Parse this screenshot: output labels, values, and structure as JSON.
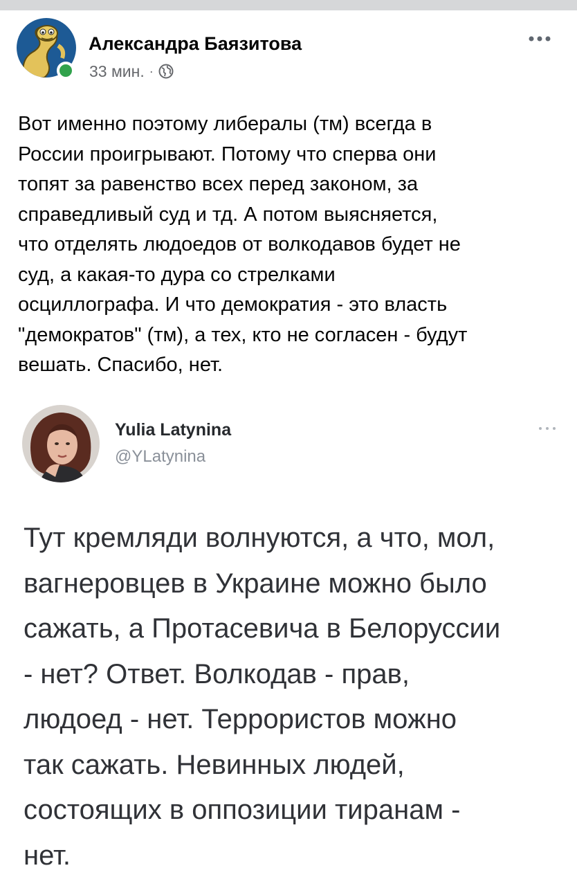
{
  "post": {
    "author": "Александра Баязитова",
    "time": "33 мин.",
    "separator": "·",
    "privacy_icon": "globe-icon",
    "more_icon": "more-horizontal-icon",
    "text_lines": [
      "Вот именно поэтому либералы (тм) всегда в",
      "России проигрывают. Потому что сперва они",
      "топят за равенство всех перед законом, за",
      "справедливый суд и тд. А потом выясняется,",
      "что отделять людоедов от волкодавов будет не",
      "суд, а какая-то дура со стрелками",
      "осциллографа. И что демократия - это власть",
      "\"демократов\" (тм), а тех, кто не согласен - будут",
      "вешать. Спасибо, нет."
    ]
  },
  "tweet": {
    "name": "Yulia Latynina",
    "handle": "@YLatynina",
    "more_icon": "more-horizontal-icon",
    "text_lines": [
      "Тут кремляди волнуются, а что, мол,",
      "вагнеровцев в Украине можно было",
      "сажать, а Протасевича в Белоруссии",
      "- нет? Ответ. Волкодав - прав,",
      "людоед - нет. Террористов можно",
      "так сажать. Невинных людей,",
      "состоящих в оппозиции тиранам -",
      "нет."
    ]
  },
  "colors": {
    "online_status": "#31a24c",
    "secondary_text": "#65676b",
    "top_strip": "#d6d7d9",
    "avatar_blue": "#1d5a95"
  }
}
